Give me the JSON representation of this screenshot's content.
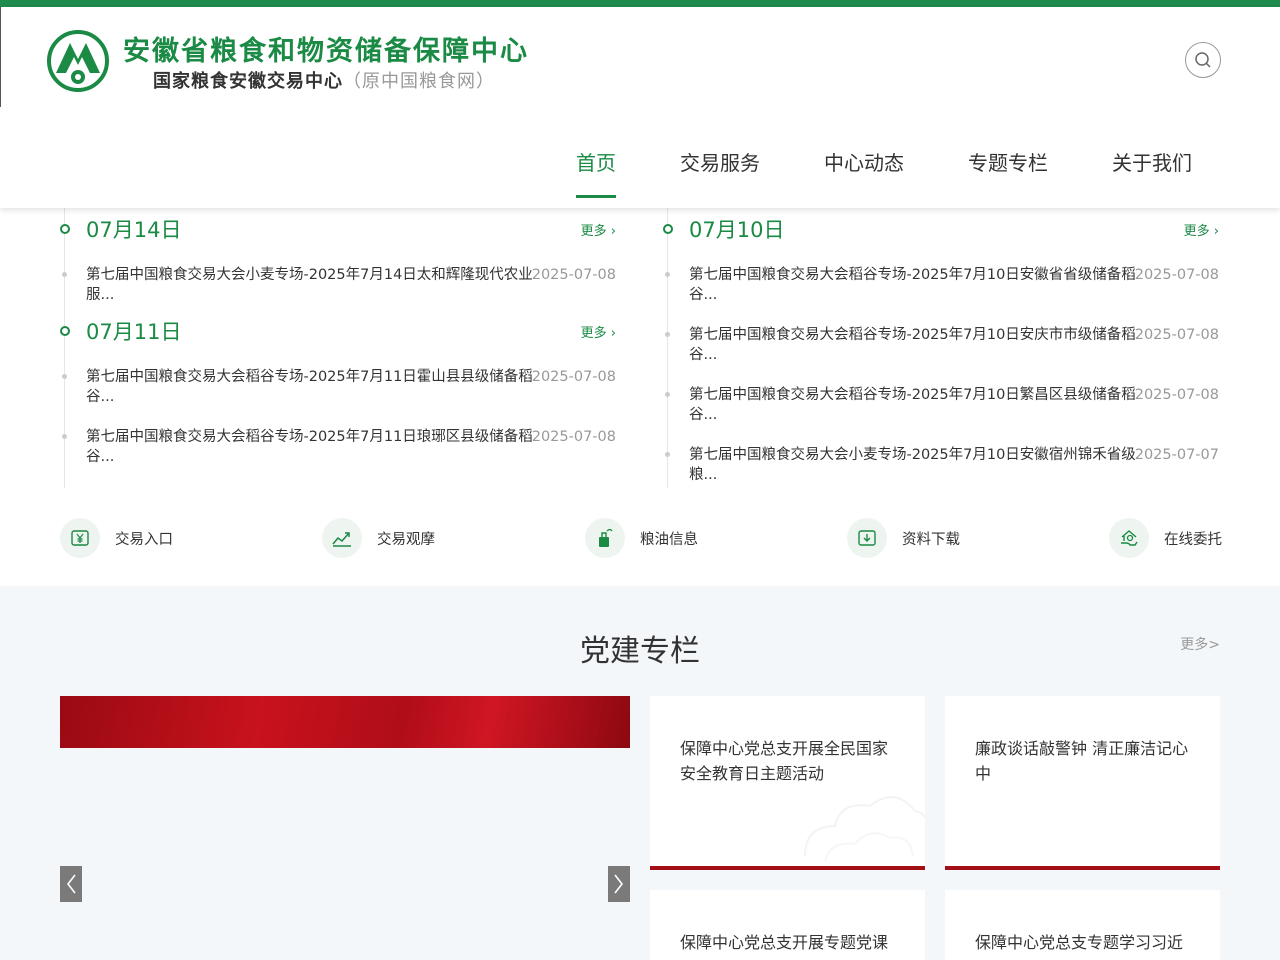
{
  "brand": {
    "title": "安徽省粮食和物资储备保障中心",
    "subtitle": "国家粮食安徽交易中心",
    "subtitle_paren": "（原中国粮食网）"
  },
  "nav": [
    {
      "label": "首页",
      "active": true
    },
    {
      "label": "交易服务",
      "active": false
    },
    {
      "label": "中心动态",
      "active": false
    },
    {
      "label": "专题专栏",
      "active": false
    },
    {
      "label": "关于我们",
      "active": false
    }
  ],
  "left_groups": [
    {
      "day": "07月14日",
      "more": "更多",
      "items": [
        {
          "title": "第七届中国粮食交易大会小麦专场-2025年7月14日太和辉隆现代农业服...",
          "date": "2025-07-08"
        }
      ]
    },
    {
      "day": "07月11日",
      "more": "更多",
      "items": [
        {
          "title": "第七届中国粮食交易大会稻谷专场-2025年7月11日霍山县县级储备稻谷...",
          "date": "2025-07-08"
        },
        {
          "title": "第七届中国粮食交易大会稻谷专场-2025年7月11日琅琊区县级储备稻谷...",
          "date": "2025-07-08"
        }
      ]
    }
  ],
  "right_groups": [
    {
      "day": "07月10日",
      "more": "更多",
      "items": [
        {
          "title": "第七届中国粮食交易大会稻谷专场-2025年7月10日安徽省省级储备稻谷...",
          "date": "2025-07-08"
        },
        {
          "title": "第七届中国粮食交易大会稻谷专场-2025年7月10日安庆市市级储备稻谷...",
          "date": "2025-07-08"
        },
        {
          "title": "第七届中国粮食交易大会稻谷专场-2025年7月10日繁昌区县级储备稻谷...",
          "date": "2025-07-08"
        },
        {
          "title": "第七届中国粮食交易大会小麦专场-2025年7月10日安徽宿州锦禾省级粮...",
          "date": "2025-07-07"
        }
      ]
    }
  ],
  "quick_links": [
    {
      "label": "交易入口",
      "icon": "yen-card-icon"
    },
    {
      "label": "交易观摩",
      "icon": "trend-chart-icon"
    },
    {
      "label": "粮油信息",
      "icon": "oil-bottle-icon"
    },
    {
      "label": "资料下载",
      "icon": "download-icon"
    },
    {
      "label": "在线委托",
      "icon": "hand-house-icon"
    }
  ],
  "party": {
    "title": "党建专栏",
    "more": "更多>",
    "cards": [
      {
        "text": "保障中心党总支开展全民国家安全教育日主题活动"
      },
      {
        "text": "廉政谈话敲警钟 清正廉洁记心中"
      },
      {
        "text": "保障中心党总支开展专题党课"
      },
      {
        "text": "保障中心党总支专题学习习近"
      }
    ]
  },
  "colors": {
    "brand_green": "#1a8a44",
    "party_red": "#a20f16"
  }
}
